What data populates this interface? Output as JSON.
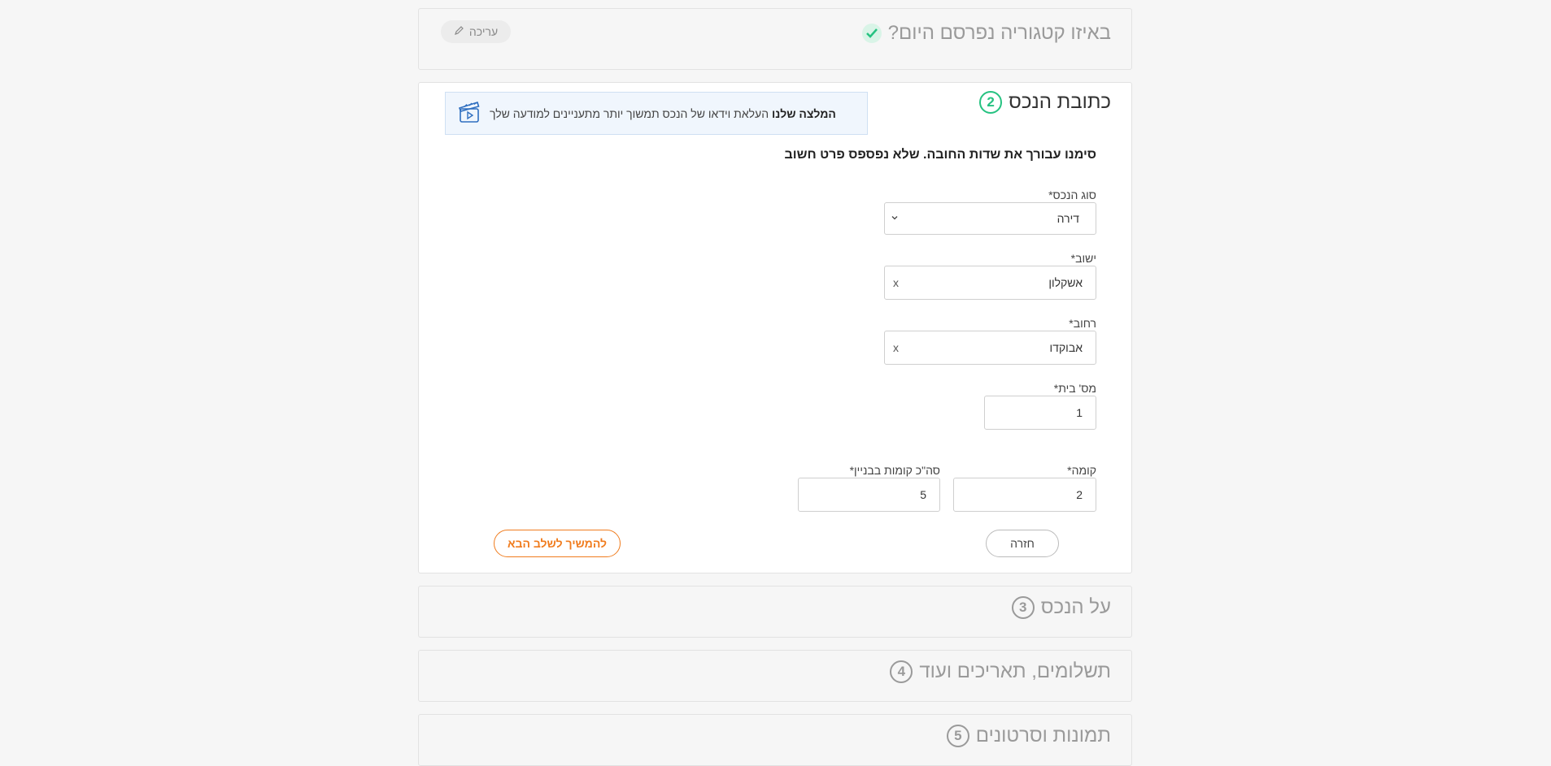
{
  "step1": {
    "title": "באיזו קטגוריה נפרסם היום?",
    "edit_label": "עריכה",
    "check_color": "#26c281"
  },
  "step2": {
    "number": "2",
    "title": "כתובת הנכס",
    "tip": {
      "bold": "המלצה שלנו",
      "text": "העלאת וידאו של הנכס תמשוך יותר מתעניינים למודעה שלך"
    },
    "note": "סימנו עבורך את שדות החובה. שלא נפספס פרט חשוב",
    "fields": {
      "property_type": {
        "label": "סוג הנכס*",
        "value": "דירה"
      },
      "city": {
        "label": "ישוב*",
        "value": "אשקלון",
        "clear": "x"
      },
      "street": {
        "label": "רחוב*",
        "value": "אבוקדו",
        "clear": "x"
      },
      "house_number": {
        "label": "מס' בית*",
        "value": "1"
      },
      "floor": {
        "label": "קומה*",
        "value": "2"
      },
      "total_floors": {
        "label": "סה\"כ קומות בבניין*",
        "value": "5"
      }
    },
    "back_label": "חזרה",
    "next_label": "להמשיך לשלב הבא"
  },
  "step3": {
    "number": "3",
    "title": "על הנכס"
  },
  "step4": {
    "number": "4",
    "title": "תשלומים, תאריכים ועוד"
  },
  "step5": {
    "number": "5",
    "title": "תמונות וסרטונים"
  },
  "colors": {
    "accent": "#f07c1e",
    "success": "#26c281"
  }
}
